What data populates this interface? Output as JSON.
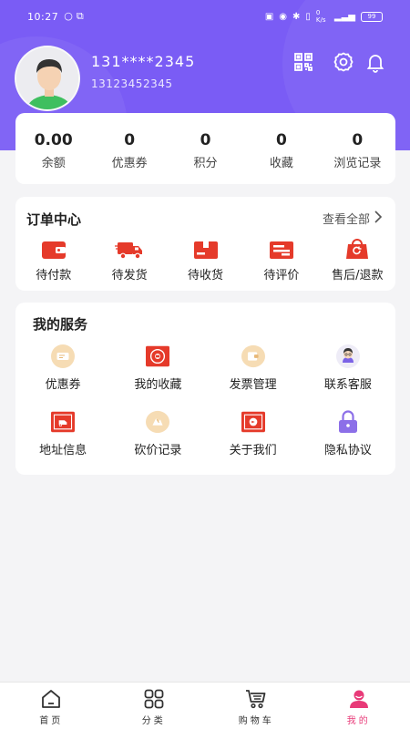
{
  "status_bar": {
    "time": "10:27",
    "speed": "0 K/s",
    "battery": "99"
  },
  "profile": {
    "username": "131****2345",
    "phone": "13123452345"
  },
  "stats": [
    {
      "value": "0.00",
      "label": "余额"
    },
    {
      "value": "0",
      "label": "优惠券"
    },
    {
      "value": "0",
      "label": "积分"
    },
    {
      "value": "0",
      "label": "收藏"
    },
    {
      "value": "0",
      "label": "浏览记录"
    }
  ],
  "orders": {
    "title": "订单中心",
    "view_all": "查看全部",
    "items": [
      {
        "label": "待付款",
        "icon": "wallet-icon"
      },
      {
        "label": "待发货",
        "icon": "truck-icon"
      },
      {
        "label": "待收货",
        "icon": "box-icon"
      },
      {
        "label": "待评价",
        "icon": "review-icon"
      },
      {
        "label": "售后/退款",
        "icon": "refund-icon"
      }
    ]
  },
  "services": {
    "title": "我的服务",
    "items": [
      {
        "label": "优惠券",
        "icon": "coupon-icon"
      },
      {
        "label": "我的收藏",
        "icon": "favorites-icon"
      },
      {
        "label": "发票管理",
        "icon": "invoice-icon"
      },
      {
        "label": "联系客服",
        "icon": "customer-service-icon"
      },
      {
        "label": "地址信息",
        "icon": "address-icon"
      },
      {
        "label": "砍价记录",
        "icon": "bargain-icon"
      },
      {
        "label": "关于我们",
        "icon": "about-icon"
      },
      {
        "label": "隐私协议",
        "icon": "privacy-lock-icon"
      }
    ]
  },
  "tabbar": [
    {
      "label": "首页",
      "icon": "home-icon"
    },
    {
      "label": "分类",
      "icon": "category-icon"
    },
    {
      "label": "购物车",
      "icon": "cart-icon"
    },
    {
      "label": "我的",
      "icon": "profile-icon",
      "active": true
    }
  ],
  "colors": {
    "brand": "#7a5cf5",
    "accent_red": "#e53a2a",
    "active_tab": "#e83a78"
  }
}
